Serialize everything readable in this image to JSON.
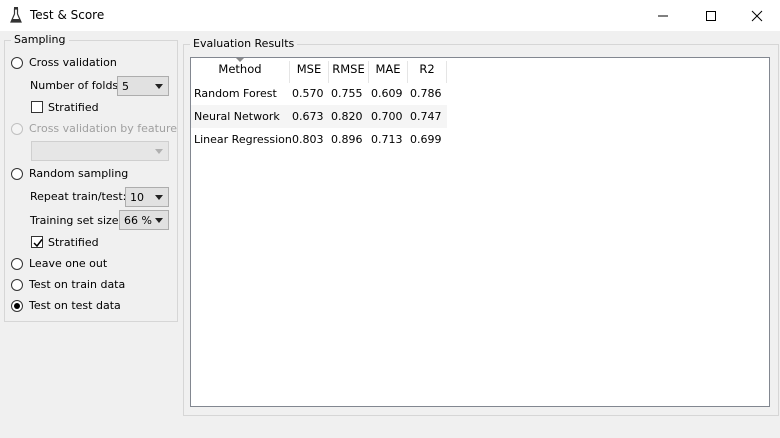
{
  "window": {
    "title": "Test & Score"
  },
  "sampling": {
    "legend": "Sampling",
    "cross_validation": "Cross validation",
    "number_of_folds_label": "Number of folds:",
    "number_of_folds_value": "5",
    "stratified_cv": "Stratified",
    "cross_validation_by_feature": "Cross validation by feature",
    "random_sampling": "Random sampling",
    "repeat_label": "Repeat train/test:",
    "repeat_value": "10",
    "training_size_label": "Training set size:",
    "training_size_value": "66 %",
    "stratified_rs": "Stratified",
    "leave_one_out": "Leave one out",
    "test_on_train": "Test on train data",
    "test_on_test": "Test on test data"
  },
  "evaluation": {
    "legend": "Evaluation Results",
    "columns": [
      "Method",
      "MSE",
      "RMSE",
      "MAE",
      "R2"
    ],
    "rows": [
      [
        "Random Forest",
        "0.570",
        "0.755",
        "0.609",
        "0.786"
      ],
      [
        "Neural Network",
        "0.673",
        "0.820",
        "0.700",
        "0.747"
      ],
      [
        "Linear Regression",
        "0.803",
        "0.896",
        "0.713",
        "0.699"
      ]
    ]
  },
  "colors": {
    "alt_row": "#f5f5f5",
    "border": "#828790"
  }
}
